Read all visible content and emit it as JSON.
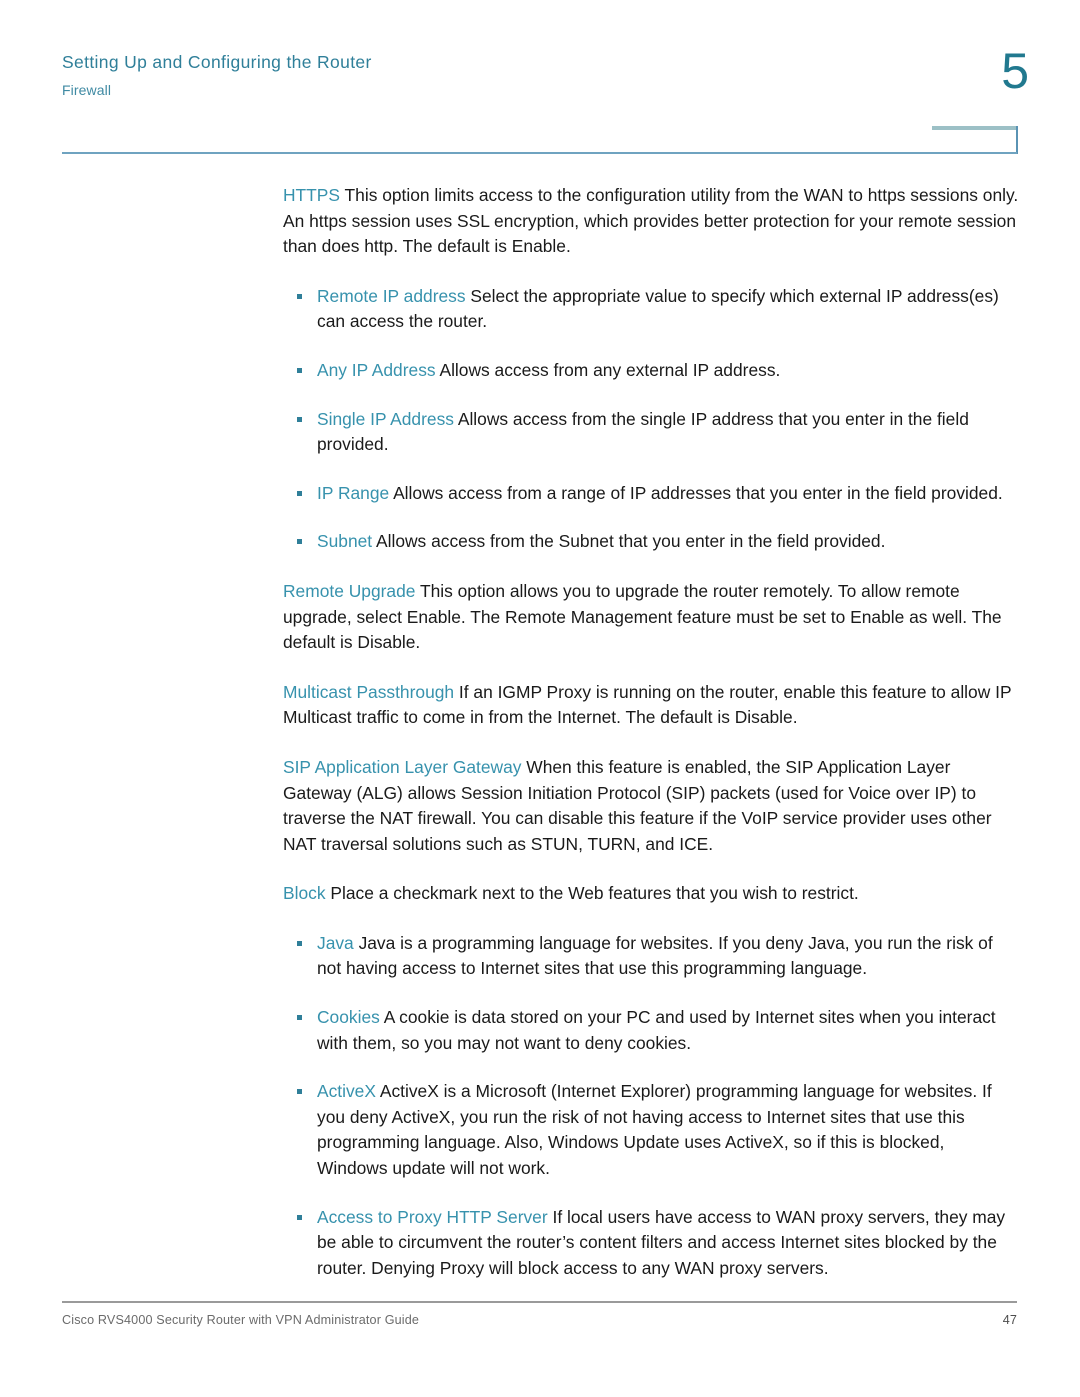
{
  "header": {
    "title": "Setting Up and Configuring the Router",
    "subtitle": "Firewall",
    "chapter_number": "5",
    "accent_color": "#2f7f99",
    "term_color": "#3792ad",
    "rule_color": "#6fa3c0"
  },
  "body": {
    "https": {
      "term": "HTTPS",
      "text": " This option limits access to the configuration utility from the WAN to https sessions only. An https session uses SSL encryption, which provides better protection for your remote session than does http. The default is Enable."
    },
    "remote_ip_bullets": [
      {
        "term": "Remote IP address",
        "text": " Select the appropriate value to specify which external IP address(es) can access the router."
      },
      {
        "term": "Any IP Address",
        "text": " Allows access from any external IP address."
      },
      {
        "term": "Single IP Address",
        "text": " Allows access from the single IP address that you enter in the field provided."
      },
      {
        "term": "IP Range",
        "text": " Allows access from a range of IP addresses that you enter in the field provided."
      },
      {
        "term": "Subnet",
        "text": " Allows access from the Subnet that you enter in the field provided."
      }
    ],
    "remote_upgrade": {
      "term": "Remote Upgrade",
      "text": " This option allows you to upgrade the router remotely. To allow remote upgrade, select Enable. The Remote Management feature must be set to Enable as well. The default is Disable."
    },
    "multicast_passthrough": {
      "term": "Multicast Passthrough",
      "text": " If an IGMP Proxy is running on the router, enable this feature to allow IP Multicast traffic to come in from the Internet. The default is Disable."
    },
    "sip_alg": {
      "term": "SIP Application Layer Gateway",
      "text": " When this feature is enabled, the SIP Application Layer Gateway (ALG) allows Session Initiation Protocol (SIP) packets (used for Voice over IP) to traverse the NAT firewall. You can disable this feature if the VoIP service provider uses other NAT traversal solutions such as STUN, TURN, and ICE."
    },
    "block": {
      "term": "Block",
      "text": " Place a checkmark next to the Web features that you wish to restrict."
    },
    "block_bullets": [
      {
        "term": "Java",
        "text": " Java is a programming language for websites. If you deny Java, you run the risk of not having access to Internet sites that use this programming language."
      },
      {
        "term": "Cookies",
        "text": " A cookie is data stored on your PC and used by Internet sites when you interact with them, so you may not want to deny cookies."
      },
      {
        "term": "ActiveX",
        "text": " ActiveX is a Microsoft (Internet Explorer) programming language for websites. If you deny ActiveX, you run the risk of not having access to Internet sites that use this programming language. Also, Windows Update uses ActiveX, so if this is blocked, Windows update will not work."
      },
      {
        "term": "Access to Proxy HTTP Server",
        "text": " If local users have access to WAN proxy servers, they may be able to circumvent the router’s content filters and access Internet sites blocked by the router. Denying Proxy will block access to any WAN proxy servers."
      }
    ]
  },
  "footer": {
    "guide_title": "Cisco RVS4000 Security Router with VPN Administrator Guide",
    "page_number": "47"
  }
}
